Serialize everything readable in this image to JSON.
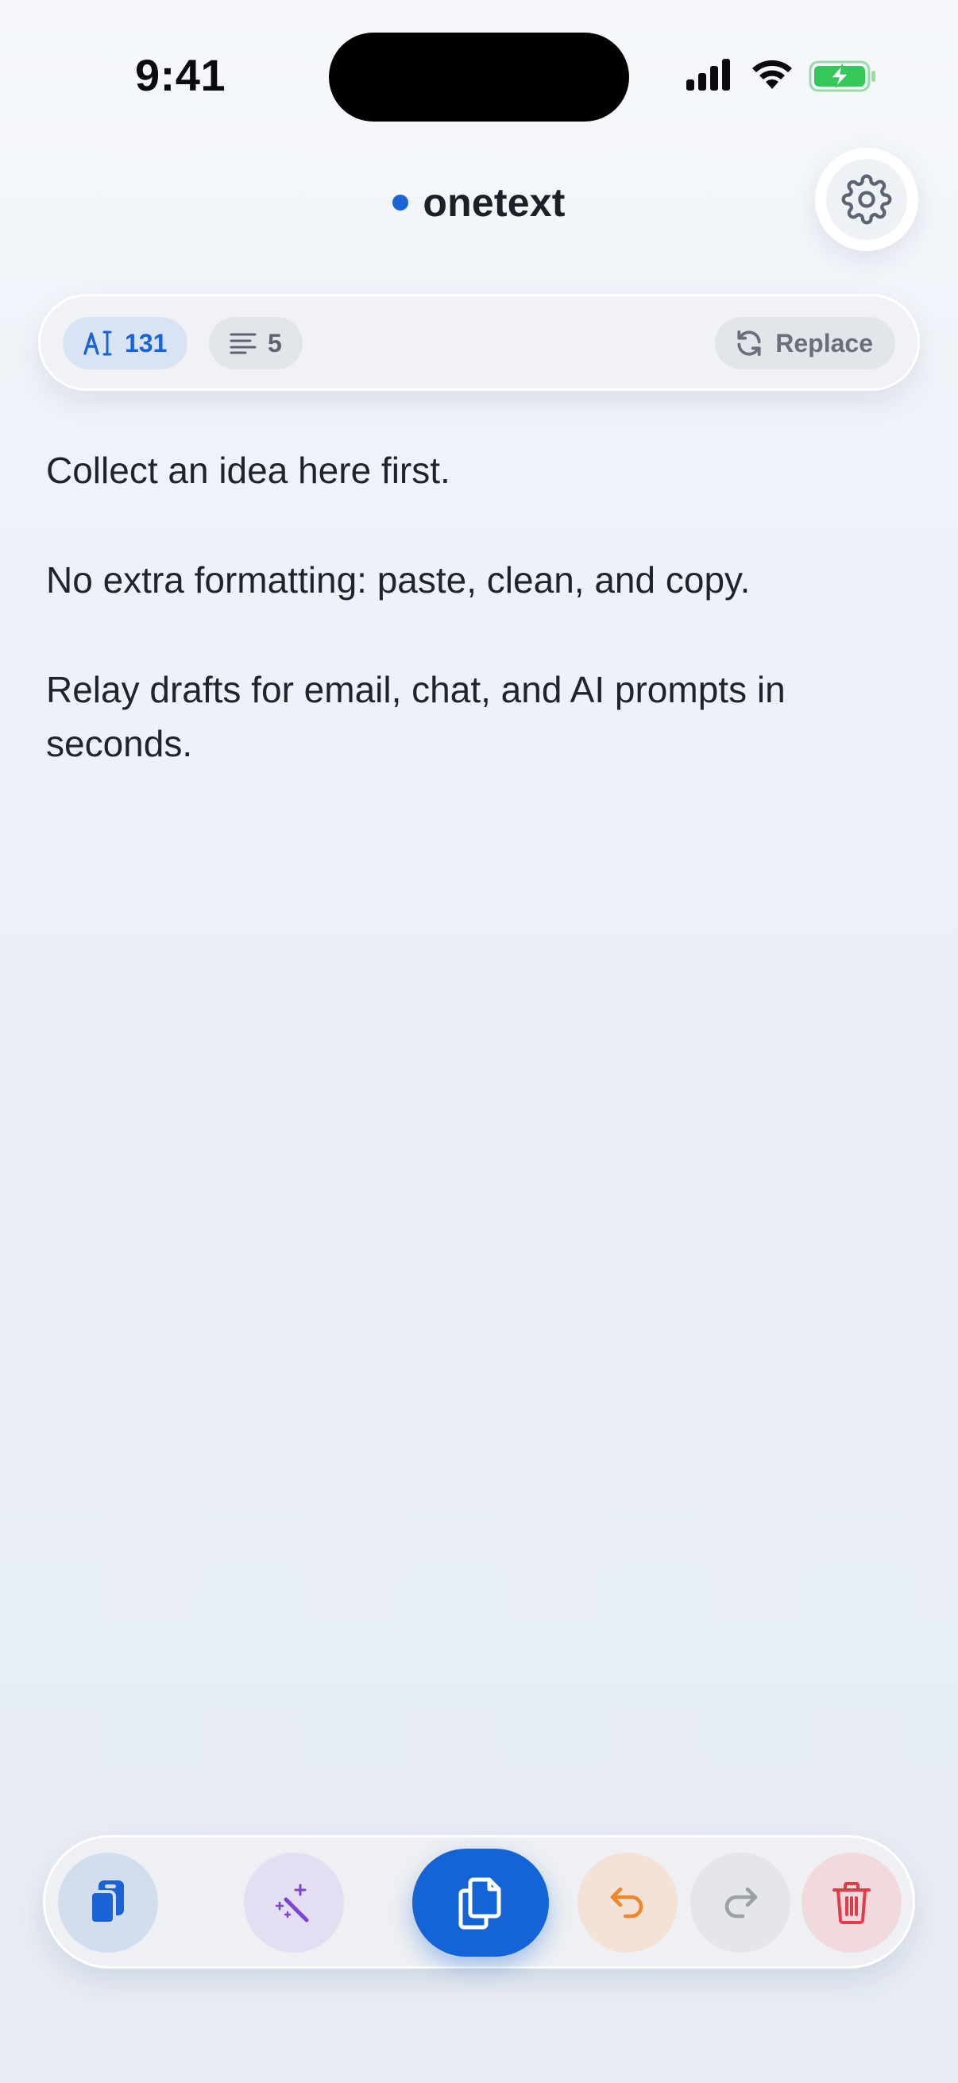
{
  "status_bar": {
    "time": "9:41",
    "icons": [
      "signal-icon",
      "wifi-icon",
      "battery-charging-icon"
    ],
    "battery_color": "#34c759"
  },
  "header": {
    "title": "onetext",
    "dot_color": "#1a62d6",
    "settings_icon": "gear-icon"
  },
  "info_bar": {
    "char_count": "131",
    "char_icon": "text-cursor-icon",
    "line_count": "5",
    "line_icon": "lines-icon",
    "replace_label": "Replace",
    "replace_icon": "refresh-icon"
  },
  "editor": {
    "paragraphs": [
      "Collect an idea here first.",
      "No extra formatting: paste, clean, and copy.",
      "Relay drafts for email, chat, and AI prompts in seconds."
    ]
  },
  "toolbar": {
    "buttons": [
      {
        "name": "paste",
        "icon": "paste-icon"
      },
      {
        "name": "magic",
        "icon": "magic-wand-icon"
      },
      {
        "name": "copy",
        "icon": "copy-icon"
      },
      {
        "name": "undo",
        "icon": "undo-icon"
      },
      {
        "name": "redo",
        "icon": "redo-icon"
      },
      {
        "name": "delete",
        "icon": "trash-icon"
      }
    ],
    "colors": {
      "primary": "#1464d8",
      "magic": "#7b45d6",
      "undo": "#f0862a",
      "redo": "#9aa0a8",
      "delete": "#e33b48"
    }
  }
}
